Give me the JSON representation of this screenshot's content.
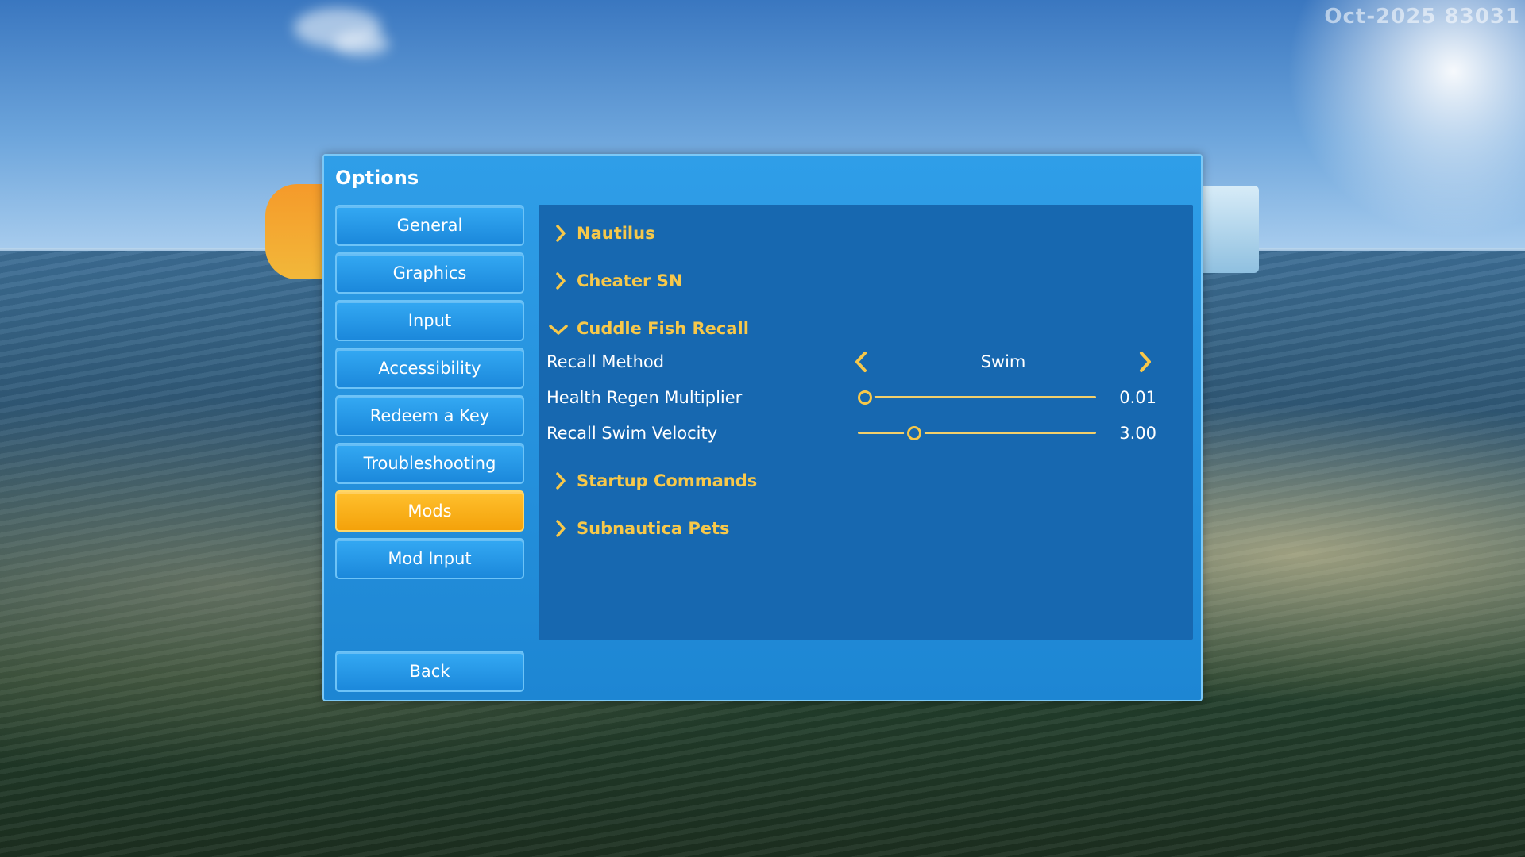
{
  "watermark": "Oct-2025 83031",
  "panel": {
    "title": "Options"
  },
  "tabs": [
    {
      "label": "General",
      "active": false
    },
    {
      "label": "Graphics",
      "active": false
    },
    {
      "label": "Input",
      "active": false
    },
    {
      "label": "Accessibility",
      "active": false
    },
    {
      "label": "Redeem a Key",
      "active": false
    },
    {
      "label": "Troubleshooting",
      "active": false
    },
    {
      "label": "Mods",
      "active": true
    },
    {
      "label": "Mod Input",
      "active": false
    }
  ],
  "back_label": "Back",
  "sections": {
    "nautilus": {
      "label": "Nautilus",
      "expanded": false
    },
    "cheater_sn": {
      "label": "Cheater SN",
      "expanded": false
    },
    "cuddle_fish_recall": {
      "label": "Cuddle Fish Recall",
      "expanded": true
    },
    "startup_commands": {
      "label": "Startup Commands",
      "expanded": false
    },
    "subnautica_pets": {
      "label": "Subnautica Pets",
      "expanded": false
    }
  },
  "options": {
    "recall_method": {
      "label": "Recall Method",
      "value": "Swim"
    },
    "health_regen": {
      "label": "Health Regen Multiplier",
      "value": "0.01",
      "fraction": 0.0
    },
    "recall_velocity": {
      "label": "Recall Swim Velocity",
      "value": "3.00",
      "fraction": 0.22
    }
  },
  "colors": {
    "accent": "#f7c84a",
    "active_tab": "#f4a20a",
    "panel": "#1d86d3",
    "content_bg": "#1768b0"
  },
  "icons": {
    "collapsed": "chevron-right-icon",
    "expanded": "chevron-down-icon",
    "prev": "arrow-left-icon",
    "next": "arrow-right-icon"
  }
}
